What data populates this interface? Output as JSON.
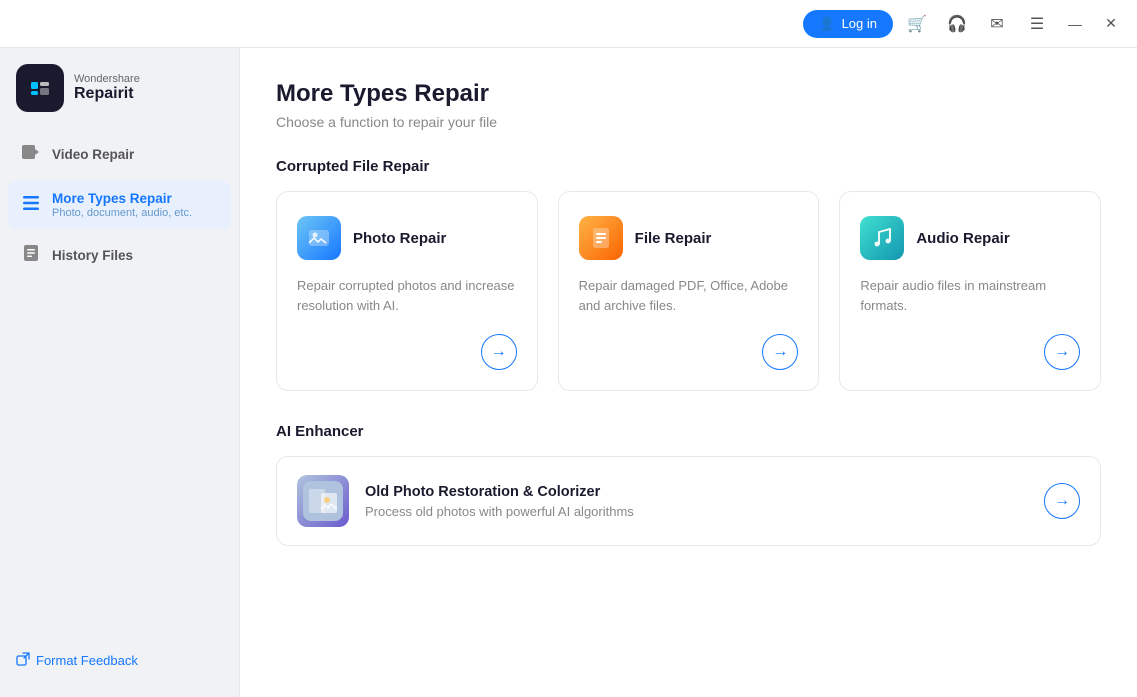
{
  "app": {
    "brand": "Wondershare",
    "product": "Repairit",
    "logo_char": "🔧"
  },
  "titlebar": {
    "login_label": "Log in",
    "cart_icon": "🛒",
    "headset_icon": "🎧",
    "mail_icon": "✉",
    "menu_icon": "☰",
    "minimize_icon": "—",
    "close_icon": "✕"
  },
  "sidebar": {
    "items": [
      {
        "id": "video-repair",
        "label": "Video Repair",
        "sub": "",
        "icon": "🎬",
        "active": false
      },
      {
        "id": "more-types-repair",
        "label": "More Types Repair",
        "sub": "Photo, document, audio, etc.",
        "icon": "☰",
        "active": true
      },
      {
        "id": "history-files",
        "label": "History Files",
        "sub": "",
        "icon": "📋",
        "active": false
      }
    ],
    "feedback": {
      "label": "Format Feedback",
      "icon": "↗"
    }
  },
  "content": {
    "page_title": "More Types Repair",
    "page_subtitle": "Choose a function to repair your file",
    "sections": [
      {
        "id": "corrupted-file-repair",
        "title": "Corrupted File Repair",
        "cards": [
          {
            "id": "photo-repair",
            "title": "Photo Repair",
            "desc": "Repair corrupted photos and increase resolution with AI.",
            "icon_char": "🖼",
            "icon_class": "blue"
          },
          {
            "id": "file-repair",
            "title": "File Repair",
            "desc": "Repair damaged PDF, Office, Adobe and archive files.",
            "icon_char": "📄",
            "icon_class": "orange"
          },
          {
            "id": "audio-repair",
            "title": "Audio Repair",
            "desc": "Repair audio files in mainstream formats.",
            "icon_char": "🎵",
            "icon_class": "teal"
          }
        ]
      },
      {
        "id": "ai-enhancer",
        "title": "AI Enhancer",
        "wide_cards": [
          {
            "id": "old-photo-restoration",
            "title": "Old Photo Restoration & Colorizer",
            "desc": "Process old photos with powerful AI algorithms",
            "icon_char": "🖼"
          }
        ]
      }
    ]
  }
}
